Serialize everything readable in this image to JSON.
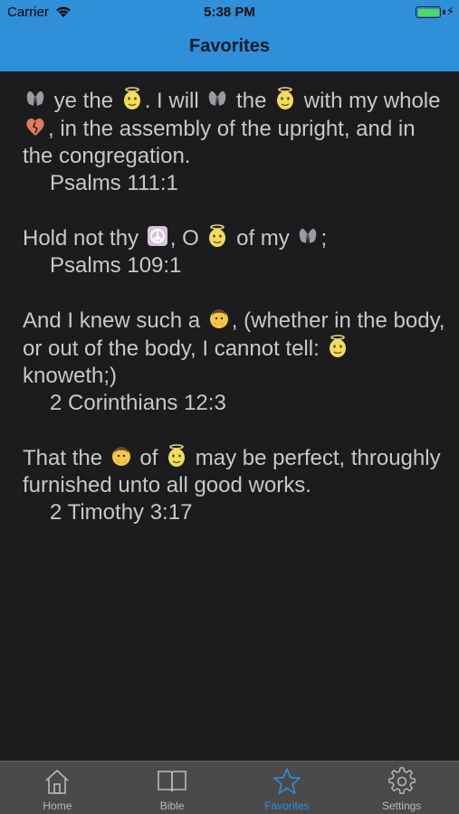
{
  "status_bar": {
    "carrier": "Carrier",
    "time": "5:38 PM",
    "battery_color": "#4cd964"
  },
  "nav": {
    "title": "Favorites",
    "background": "#2f8fd8"
  },
  "verses": [
    {
      "parts": [
        {
          "emoji": "praying-hands-icon"
        },
        {
          "text": " ye the "
        },
        {
          "emoji": "angel-face-icon"
        },
        {
          "text": ". I will "
        },
        {
          "emoji": "praying-hands-icon"
        },
        {
          "text": " the "
        },
        {
          "emoji": "angel-face-icon"
        },
        {
          "text": " with my whole "
        },
        {
          "emoji": "heart-icon"
        },
        {
          "text": ", in the assembly of the upright, and in the congregation."
        }
      ],
      "ref": "Psalms 111:1"
    },
    {
      "parts": [
        {
          "text": "Hold not thy "
        },
        {
          "emoji": "peace-symbol-icon"
        },
        {
          "text": ", O "
        },
        {
          "emoji": "angel-face-icon"
        },
        {
          "text": " of my "
        },
        {
          "emoji": "praying-hands-icon"
        },
        {
          "text": ";"
        }
      ],
      "ref": "Psalms 109:1"
    },
    {
      "parts": [
        {
          "text": "And I knew such a "
        },
        {
          "emoji": "man-face-icon"
        },
        {
          "text": ", (whether in the body, or out of the body, I cannot tell: "
        },
        {
          "emoji": "angel-face-icon"
        },
        {
          "text": " knoweth;)"
        }
      ],
      "ref": "2 Corinthians 12:3"
    },
    {
      "parts": [
        {
          "text": "That the "
        },
        {
          "emoji": "man-face-icon"
        },
        {
          "text": " of "
        },
        {
          "emoji": "angel-face-icon"
        },
        {
          "text": " may be perfect, throughly furnished unto all good works."
        }
      ],
      "ref": "2 Timothy 3:17"
    }
  ],
  "tabs": [
    {
      "label": "Home",
      "icon": "home-icon",
      "active": false
    },
    {
      "label": "Bible",
      "icon": "book-icon",
      "active": false
    },
    {
      "label": "Favorites",
      "icon": "star-icon",
      "active": true
    },
    {
      "label": "Settings",
      "icon": "gear-icon",
      "active": false
    }
  ],
  "colors": {
    "background": "#1c1c1e",
    "text": "#c8c8c8",
    "tabbar": "#4a4a4c",
    "active_tab": "#2f8fd8",
    "inactive_tab": "#b9b9b9"
  }
}
